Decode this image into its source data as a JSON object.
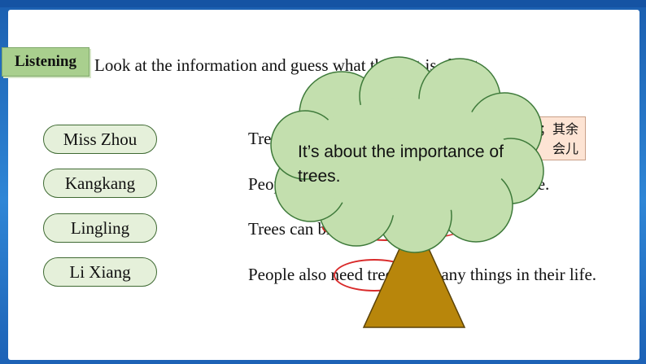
{
  "tag": {
    "label": "Listening"
  },
  "instruction": "Look at the information and guess what the text is about.",
  "names": [
    "Miss Zhou",
    "Kangkang",
    "Lingling",
    "Li Xiang"
  ],
  "sentences": [
    "Trees",
    "People",
    "Trees can bring us fresh air.",
    "People also need trees for many things in their life."
  ],
  "sentence_fragments": {
    "s2_right": "a tree."
  },
  "note": {
    "line1": "；其余",
    "line2": "会儿"
  },
  "bubble": {
    "text": "It’s about the importance of trees."
  },
  "colors": {
    "background": "#2f86d6",
    "tag": "#a9cf8e",
    "pill": "#e5f0da",
    "canopy": "#c3dfae",
    "trunk": "#b8860b",
    "highlight": "#d92a2a",
    "note_bg": "#fde4d4"
  }
}
